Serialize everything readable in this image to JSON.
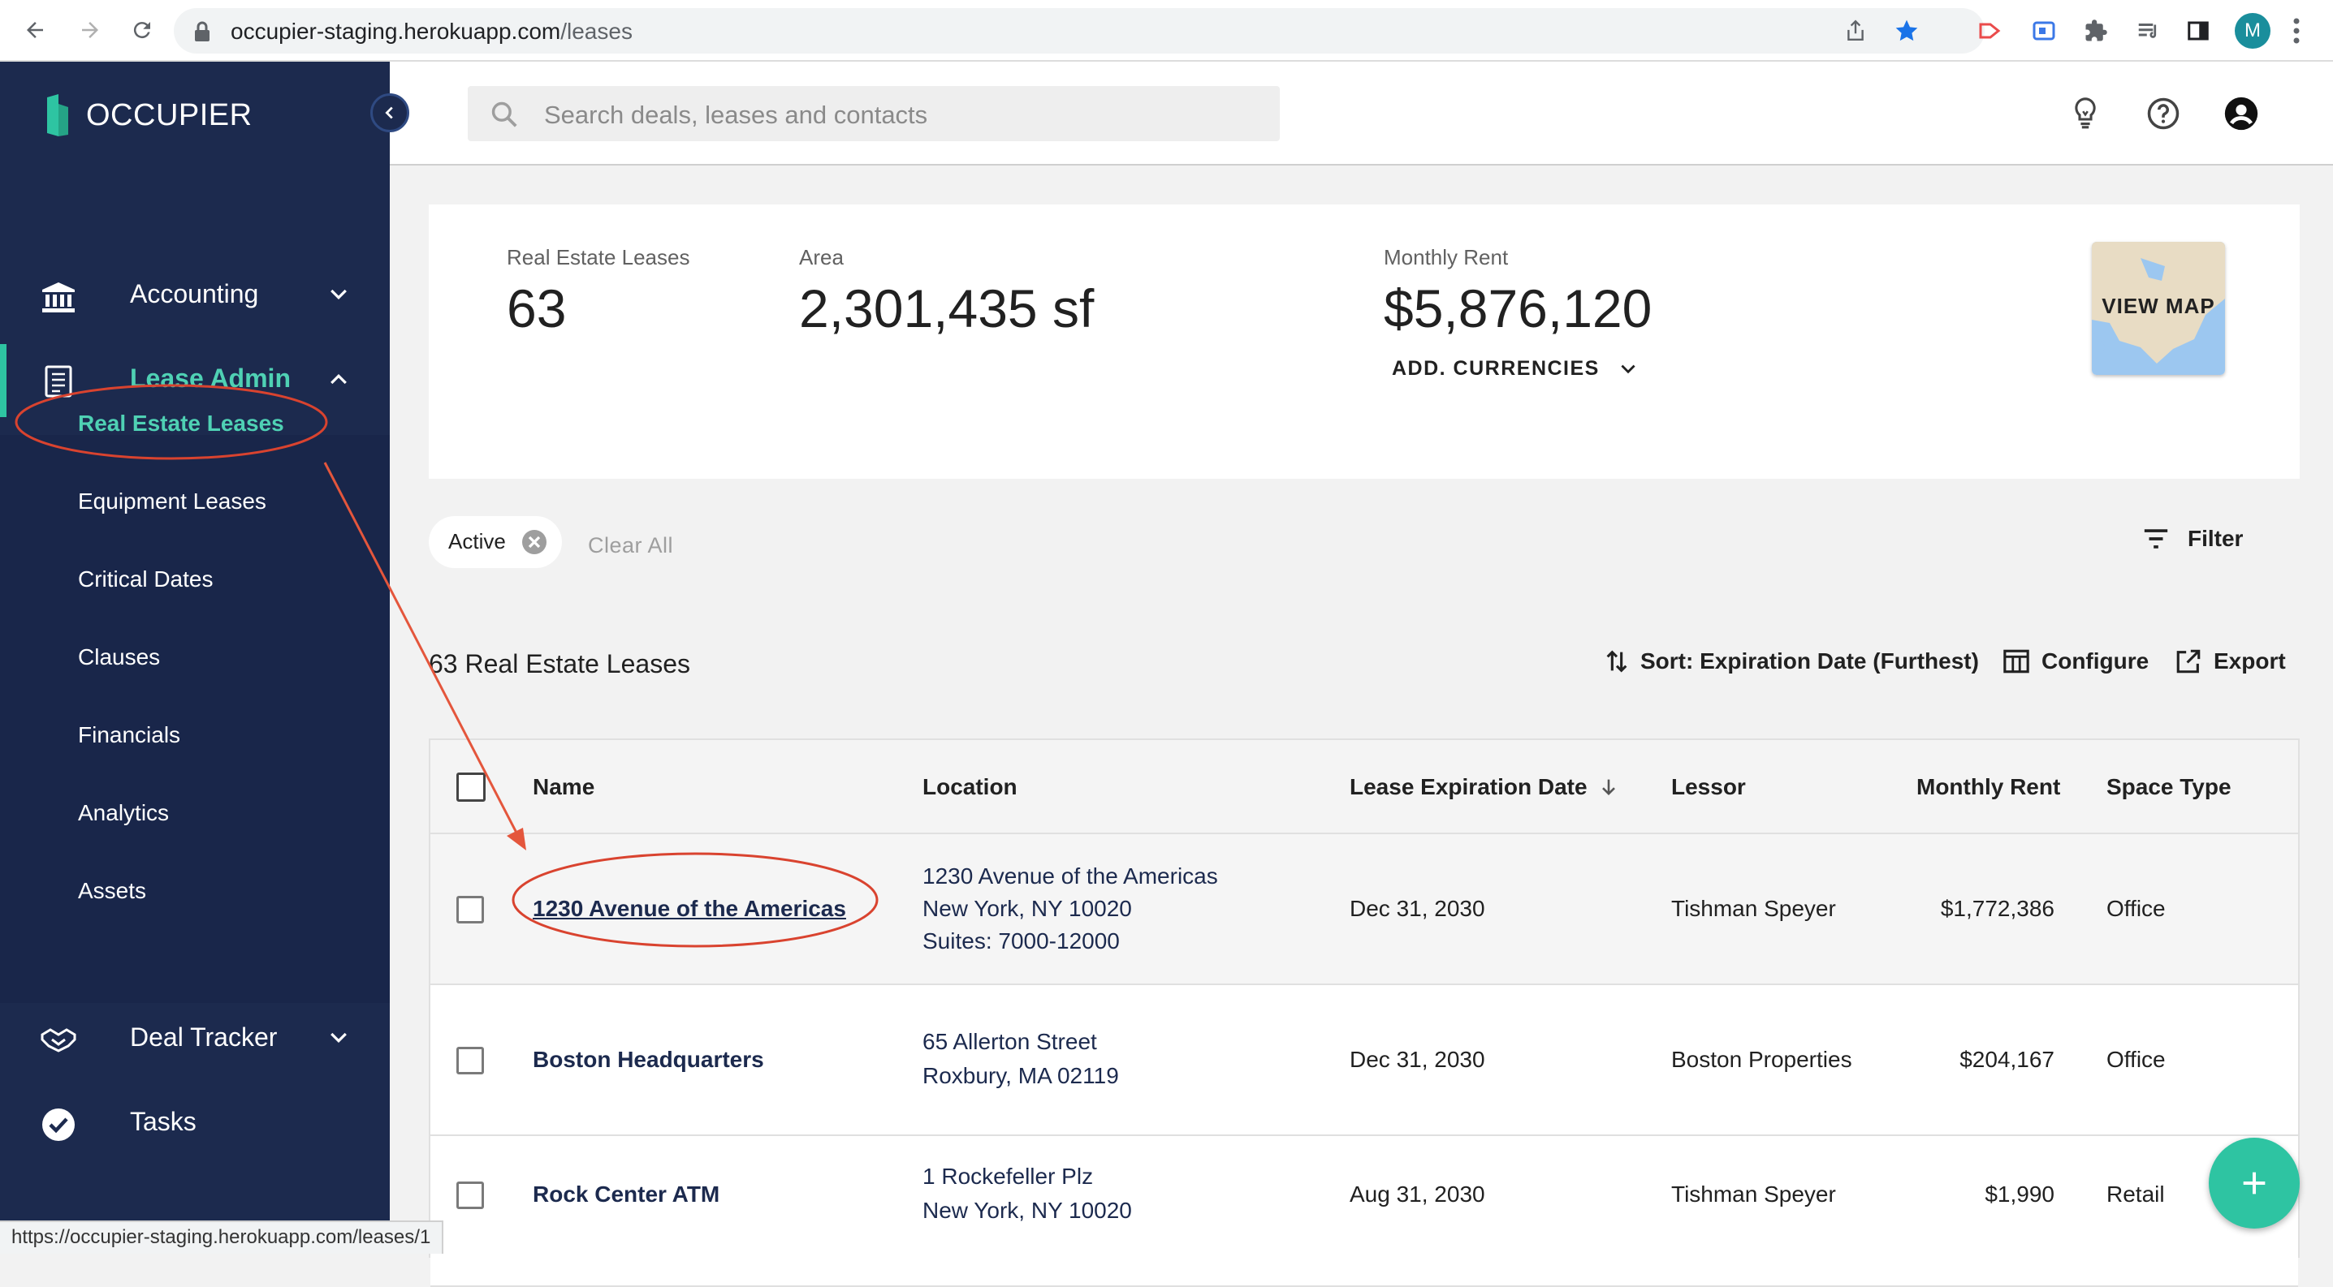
{
  "browser": {
    "url_host": "occupier-staging.herokuapp.com",
    "url_path": "/leases",
    "profile_initial": "M",
    "status_url": "https://occupier-staging.herokuapp.com/leases/1"
  },
  "brand": {
    "name": "OCCUPIER",
    "accent": "#2ec4a2",
    "sidebar_bg": "#1c2a4e"
  },
  "sidebar": {
    "groups": [
      {
        "label": "Accounting",
        "icon": "bank-icon"
      },
      {
        "label": "Lease Admin",
        "icon": "document-icon"
      },
      {
        "label": "Deal Tracker",
        "icon": "handshake-icon"
      },
      {
        "label": "Tasks",
        "icon": "check-circle-icon"
      }
    ],
    "lease_admin_items": [
      {
        "label": "Real Estate Leases"
      },
      {
        "label": "Equipment Leases"
      },
      {
        "label": "Critical Dates"
      },
      {
        "label": "Clauses"
      },
      {
        "label": "Financials"
      },
      {
        "label": "Analytics"
      },
      {
        "label": "Assets"
      }
    ]
  },
  "search": {
    "placeholder": "Search deals, leases and contacts"
  },
  "summary": {
    "leases_label": "Real Estate Leases",
    "leases_value": "63",
    "area_label": "Area",
    "area_value": "2,301,435 sf",
    "rent_label": "Monthly Rent",
    "rent_value": "$5,876,120",
    "add_currencies": "ADD. CURRENCIES",
    "view_map": "VIEW MAP"
  },
  "filters": {
    "chip": "Active",
    "clear_all": "Clear All",
    "filter": "Filter"
  },
  "toolbar": {
    "count_title": "63 Real Estate Leases",
    "sort": "Sort: Expiration Date (Furthest)",
    "configure": "Configure",
    "export": "Export"
  },
  "table": {
    "columns": {
      "name": "Name",
      "location": "Location",
      "expiration": "Lease Expiration Date",
      "lessor": "Lessor",
      "rent": "Monthly Rent",
      "space": "Space Type"
    },
    "rows": [
      {
        "name": "1230 Avenue of the Americas",
        "loc1": "1230 Avenue of the Americas",
        "loc2": "New York, NY 10020",
        "loc3": "Suites: 7000-12000",
        "expiration": "Dec 31, 2030",
        "lessor": "Tishman Speyer",
        "rent": "$1,772,386",
        "space": "Office"
      },
      {
        "name": "Boston Headquarters",
        "loc1": "65 Allerton Street",
        "loc2": "Roxbury, MA 02119",
        "expiration": "Dec 31, 2030",
        "lessor": "Boston Properties",
        "rent": "$204,167",
        "space": "Office"
      },
      {
        "name": "Rock Center ATM",
        "loc1": "1 Rockefeller Plz",
        "loc2": "New York, NY 10020",
        "expiration": "Aug 31, 2030",
        "lessor": "Tishman Speyer",
        "rent": "$1,990",
        "space": "Retail"
      }
    ]
  }
}
